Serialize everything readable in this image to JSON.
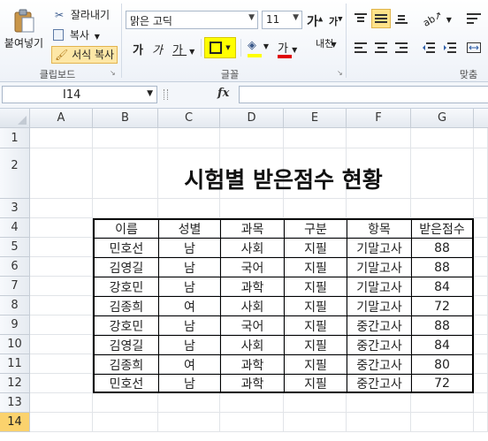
{
  "ribbon": {
    "clipboard": {
      "paste_label": "붙여넣기",
      "cut_label": "잘라내기",
      "copy_label": "복사",
      "format_painter_label": "서식 복사",
      "group_label": "클립보드"
    },
    "font": {
      "font_name": "맑은 고딕",
      "font_size": "11",
      "grow_label": "가",
      "shrink_label": "가",
      "bold_label": "가",
      "italic_label": "가",
      "underline_label": "가",
      "font_color_label": "가",
      "phonetic_label": "내천",
      "group_label": "글꼴",
      "border_highlight": "#ffff00",
      "font_color": "#e00000",
      "fill_color": "#ffff00"
    },
    "alignment": {
      "group_label": "맞춤"
    }
  },
  "formula_bar": {
    "name_box": "I14",
    "fx_label": "fx",
    "formula": ""
  },
  "grid": {
    "columns": [
      "A",
      "B",
      "C",
      "D",
      "E",
      "F",
      "G"
    ],
    "rows": [
      "1",
      "2",
      "3",
      "4",
      "5",
      "6",
      "7",
      "8",
      "9",
      "10",
      "11",
      "12",
      "13",
      "14"
    ],
    "selected_row": "14",
    "title": "시험별 받은점수 현황"
  },
  "table": {
    "headers": [
      "이름",
      "성별",
      "과목",
      "구분",
      "항목",
      "받은점수"
    ],
    "rows": [
      [
        "민호선",
        "남",
        "사회",
        "지필",
        "기말고사",
        "88"
      ],
      [
        "김영길",
        "남",
        "국어",
        "지필",
        "기말고사",
        "88"
      ],
      [
        "강호민",
        "남",
        "과학",
        "지필",
        "기말고사",
        "84"
      ],
      [
        "김종희",
        "여",
        "사회",
        "지필",
        "기말고사",
        "72"
      ],
      [
        "강호민",
        "남",
        "국어",
        "지필",
        "중간고사",
        "88"
      ],
      [
        "김영길",
        "남",
        "사회",
        "지필",
        "중간고사",
        "84"
      ],
      [
        "김종희",
        "여",
        "과학",
        "지필",
        "중간고사",
        "80"
      ],
      [
        "민호선",
        "남",
        "과학",
        "지필",
        "중간고사",
        "72"
      ]
    ]
  }
}
